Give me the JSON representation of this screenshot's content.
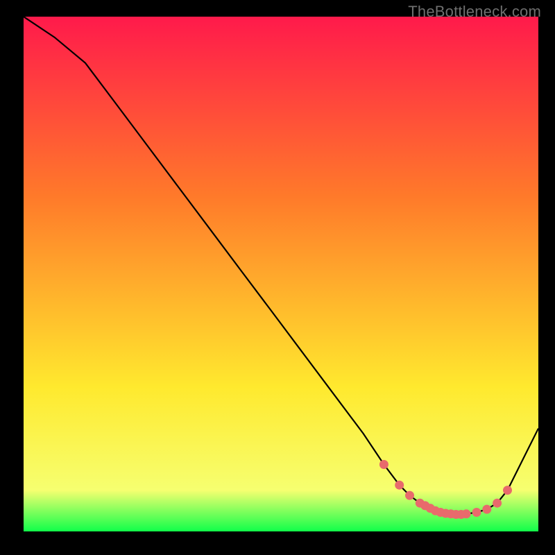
{
  "watermark": "TheBottleneck.com",
  "colors": {
    "bg": "#000000",
    "curve": "#000000",
    "marker_fill": "#e86a6c",
    "marker_stroke": "#e86a6c",
    "gradient_top": "#ff1a4b",
    "gradient_mid1": "#ff7a2a",
    "gradient_mid2": "#ffe92e",
    "gradient_low": "#f6ff70",
    "gradient_bottom": "#10ff4a",
    "watermark": "#6f6f6f"
  },
  "chart_data": {
    "type": "line",
    "title": "",
    "xlabel": "",
    "ylabel": "",
    "xlim": [
      0,
      100
    ],
    "ylim": [
      0,
      100
    ],
    "series": [
      {
        "name": "bottleneck-curve",
        "x": [
          0,
          6,
          12,
          18,
          24,
          30,
          36,
          42,
          48,
          54,
          60,
          66,
          70,
          73,
          75,
          77,
          79,
          80,
          81,
          82,
          83,
          84,
          85,
          86,
          88,
          90,
          92,
          94,
          96,
          100
        ],
        "y": [
          100,
          96,
          91,
          83,
          75,
          67,
          59,
          51,
          43,
          35,
          27,
          19,
          13,
          9,
          7,
          5.5,
          4.5,
          4,
          3.7,
          3.5,
          3.4,
          3.3,
          3.3,
          3.4,
          3.7,
          4.3,
          5.5,
          8,
          12,
          20
        ]
      }
    ],
    "markers": {
      "x": [
        70,
        73,
        75,
        77,
        78,
        79,
        80,
        81,
        82,
        83,
        84,
        85,
        86,
        88,
        90,
        92,
        94
      ],
      "y": [
        13,
        9,
        7,
        5.5,
        5,
        4.5,
        4,
        3.7,
        3.5,
        3.4,
        3.3,
        3.3,
        3.4,
        3.7,
        4.3,
        5.5,
        8
      ]
    }
  }
}
